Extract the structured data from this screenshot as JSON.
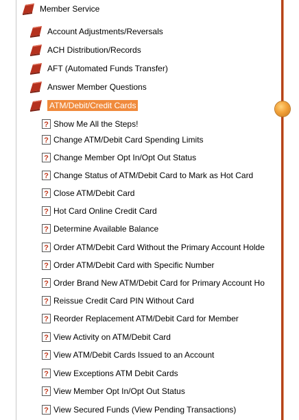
{
  "tree": {
    "root": {
      "label": "Member Service",
      "icon": "book-icon"
    },
    "categories": [
      {
        "label": "Account Adjustments/Reversals",
        "icon": "book-icon"
      },
      {
        "label": "ACH Distribution/Records",
        "icon": "book-icon"
      },
      {
        "label": "AFT (Automated Funds Transfer)",
        "icon": "book-icon"
      },
      {
        "label": "Answer Member Questions",
        "icon": "book-icon"
      },
      {
        "label": "ATM/Debit/Credit Cards",
        "icon": "book-icon",
        "selected": true
      }
    ],
    "topics": [
      {
        "label": "Show Me All the Steps!",
        "icon": "help-topic-icon"
      },
      {
        "label": "Change ATM/Debit Card Spending Limits",
        "icon": "help-topic-icon"
      },
      {
        "label": "Change Member Opt In/Opt Out Status",
        "icon": "help-topic-icon"
      },
      {
        "label": "Change Status of ATM/Debit Card to Mark as Hot Card",
        "icon": "help-topic-icon"
      },
      {
        "label": "Close ATM/Debit Card",
        "icon": "help-topic-icon"
      },
      {
        "label": "Hot Card Online Credit Card",
        "icon": "help-topic-icon"
      },
      {
        "label": "Determine Available Balance",
        "icon": "help-topic-icon"
      },
      {
        "label": "Order ATM/Debit Card Without the Primary Account Holde",
        "icon": "help-topic-icon"
      },
      {
        "label": "Order ATM/Debit Card with Specific Number",
        "icon": "help-topic-icon"
      },
      {
        "label": "Order Brand New ATM/Debit Card for Primary Account Ho",
        "icon": "help-topic-icon"
      },
      {
        "label": "Reissue Credit Card PIN Without Card",
        "icon": "help-topic-icon"
      },
      {
        "label": "Reorder Replacement ATM/Debit Card for Member",
        "icon": "help-topic-icon"
      },
      {
        "label": "View Activity on ATM/Debit Card",
        "icon": "help-topic-icon"
      },
      {
        "label": "View ATM/Debit Cards Issued to an Account",
        "icon": "help-topic-icon"
      },
      {
        "label": "View Exceptions ATM Debit Cards",
        "icon": "help-topic-icon"
      },
      {
        "label": "View Member Opt In/Opt Out Status",
        "icon": "help-topic-icon"
      },
      {
        "label": "View Secured Funds (View Pending Transactions)",
        "icon": "help-topic-icon"
      }
    ]
  },
  "colors": {
    "selection_bg": "#f08a3c",
    "rail": "#b5431a",
    "book_red": "#b5311e"
  }
}
